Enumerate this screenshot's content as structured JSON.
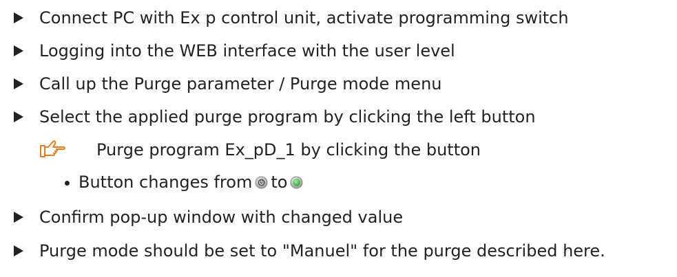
{
  "steps_top": [
    {
      "text": "Connect PC with Ex p control unit, activate programming switch"
    },
    {
      "text": "Logging into the WEB interface with the user level"
    },
    {
      "text": "Call up the Purge parameter / Purge mode menu"
    },
    {
      "text": "Select the applied purge program by clicking the left button"
    }
  ],
  "hint": {
    "icon": "pointing-hand-icon",
    "text": "Purge program Ex_pD_1 by clicking the button"
  },
  "bullet": {
    "text_before": "Button changes from",
    "text_middle": "to",
    "icon_from": "power-button-off-icon",
    "icon_to": "power-button-on-icon"
  },
  "steps_bottom": [
    {
      "text": "Confirm pop-up window with changed value"
    },
    {
      "text": "Purge mode should be set to \"Manuel\" for the purge described here."
    }
  ],
  "colors": {
    "text": "#222222",
    "hand_icon": "#f07a1a",
    "button_off": "#7a7a7a",
    "button_on": "#3fbf3f"
  }
}
